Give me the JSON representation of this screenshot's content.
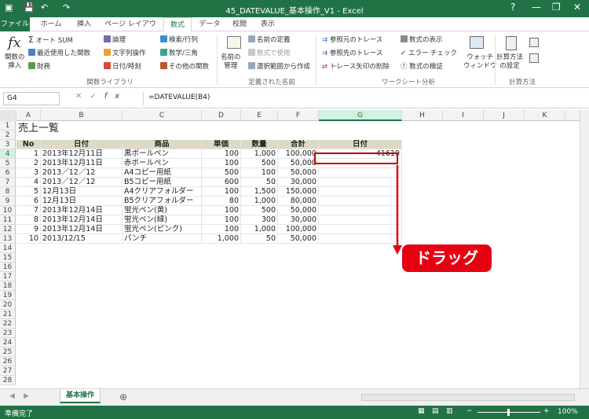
{
  "title_bar": {
    "title": "45_DATEVALUE_基本操作_V1 - Excel",
    "help": "?",
    "minimize": "—",
    "restore": "❐",
    "close": "✕"
  },
  "quick_access": {
    "save": "💾",
    "undo": "↶",
    "redo": "↷"
  },
  "tabs": {
    "file": "ファイル",
    "home": "ホーム",
    "insert": "挿入",
    "page_layout": "ページ レイアウト",
    "formulas": "数式",
    "data": "データ",
    "review": "校閲",
    "view": "表示"
  },
  "ribbon": {
    "insert_function": "関数の\n挿入",
    "autosum": "オート SUM",
    "recent": "最近使用した関数",
    "financial": "財務",
    "logical": "論理",
    "text": "文字列操作",
    "datetime": "日付/時刻",
    "lookup": "検索/行列",
    "math": "数学/三角",
    "more": "その他の関数",
    "group_library": "関数ライブラリ",
    "name_manager": "名前の\n管理",
    "define_name": "名前の定義",
    "use_in_formula": "数式で使用",
    "create_from_selection": "選択範囲から作成",
    "group_names": "定義された名前",
    "trace_precedents": "参照元のトレース",
    "trace_dependents": "参照先のトレース",
    "remove_arrows": "トレース矢印の削除",
    "show_formulas": "数式の表示",
    "error_checking": "エラー チェック",
    "evaluate_formula": "数式の検証",
    "watch_window": "ウォッチ\nウィンドウ",
    "group_auditing": "ワークシート分析",
    "calc_options": "計算方法\nの設定",
    "group_calc": "計算方法"
  },
  "formula_bar": {
    "name_box": "G4",
    "formula": "=DATEVALUE(B4)",
    "fx": "fx"
  },
  "columns": [
    "A",
    "B",
    "C",
    "D",
    "E",
    "F",
    "G",
    "H",
    "I",
    "J",
    "K"
  ],
  "rows": [
    "1",
    "2",
    "3",
    "4",
    "5",
    "6",
    "7",
    "8",
    "9",
    "10",
    "11",
    "12",
    "13",
    "14",
    "15",
    "16",
    "17",
    "18",
    "19",
    "20",
    "21",
    "22",
    "23",
    "24",
    "25",
    "26",
    "27",
    "28"
  ],
  "sheet": {
    "title": "売上一覧",
    "headers": [
      "No",
      "日付",
      "商品",
      "単価",
      "数量",
      "合計",
      "日付"
    ],
    "data": [
      [
        "1",
        "2013年12月11日",
        "黒ボールペン",
        "100",
        "1,000",
        "100,000",
        "41619"
      ],
      [
        "2",
        "2013年12月11日",
        "赤ボールペン",
        "100",
        "500",
        "50,000",
        ""
      ],
      [
        "3",
        "2013／12／12",
        "A4コピー用紙",
        "500",
        "100",
        "50,000",
        ""
      ],
      [
        "4",
        "2013／12／12",
        "B5コピー用紙",
        "600",
        "50",
        "30,000",
        ""
      ],
      [
        "5",
        "12月13日",
        "A4クリアフォルダー",
        "100",
        "1,500",
        "150,000",
        ""
      ],
      [
        "6",
        "12月13日",
        "B5クリアフォルダー",
        "80",
        "1,000",
        "80,000",
        ""
      ],
      [
        "7",
        "2013年12月14日",
        "蛍光ペン(黄)",
        "100",
        "500",
        "50,000",
        ""
      ],
      [
        "8",
        "2013年12月14日",
        "蛍光ペン(緑)",
        "100",
        "300",
        "30,000",
        ""
      ],
      [
        "9",
        "2013年12月14日",
        "蛍光ペン(ピンク)",
        "100",
        "1,000",
        "100,000",
        ""
      ],
      [
        "10",
        "2013/12/15",
        "パンチ",
        "1,000",
        "50",
        "50,000",
        ""
      ]
    ]
  },
  "callout": "ドラッグ",
  "sheet_tab": "基本操作",
  "add_sheet": "⊕",
  "status": {
    "ready": "準備完了",
    "zoom": "100%"
  },
  "colors": {
    "excel_green": "#217346",
    "header_fill": "#ddd9c4",
    "callout_red": "#e60012"
  }
}
